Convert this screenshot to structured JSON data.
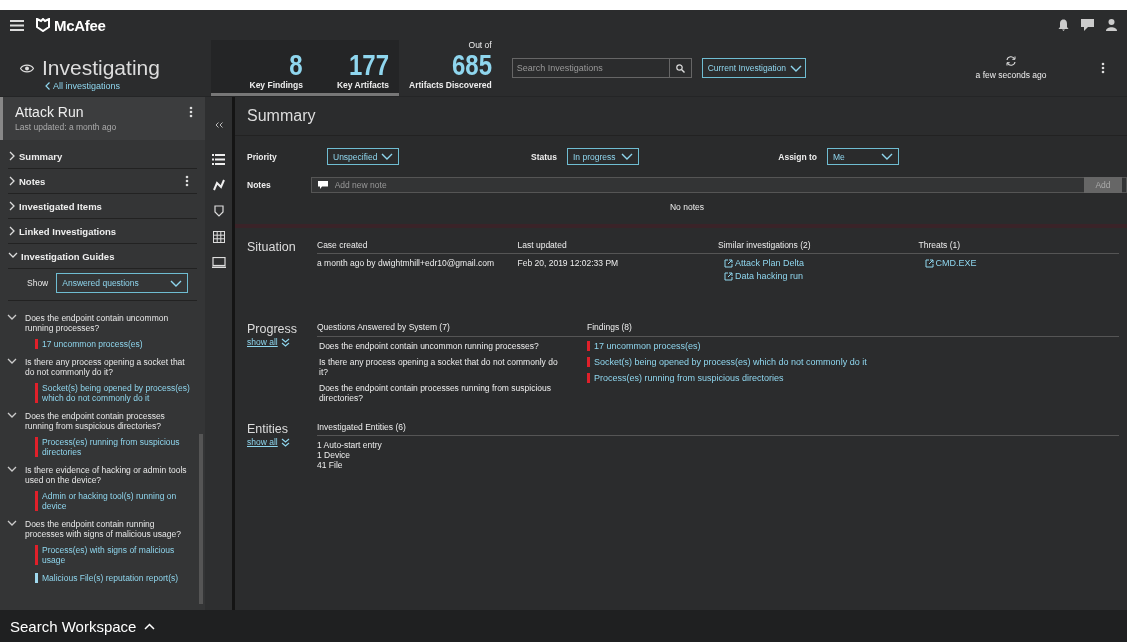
{
  "top_bar": {
    "logo": "McAfee"
  },
  "header": {
    "title": "Investigating",
    "back_link": "All investigations",
    "stats": [
      {
        "value": "8",
        "label": "Key Findings"
      },
      {
        "value": "177",
        "label": "Key Artifacts"
      }
    ],
    "total": {
      "caption": "Out of",
      "value": "685",
      "label": "Artifacts Discovered"
    },
    "search": {
      "placeholder": "Search Investigations"
    },
    "scope": {
      "value": "Current Investigation"
    },
    "refresh": {
      "text": "a few seconds ago"
    }
  },
  "sidebar": {
    "title": "Attack Run",
    "subtitle": "Last updated: a month ago",
    "sections": [
      {
        "label": "Summary",
        "expanded": false,
        "menu": false
      },
      {
        "label": "Notes",
        "expanded": false,
        "menu": true
      },
      {
        "label": "Investigated Items",
        "expanded": false,
        "menu": false
      },
      {
        "label": "Linked Investigations",
        "expanded": false,
        "menu": false
      },
      {
        "label": "Investigation Guides",
        "expanded": true,
        "menu": false
      }
    ],
    "show_label": "Show",
    "show_value": "Answered questions",
    "guides": [
      {
        "question": "Does the endpoint contain uncommon running processes?",
        "expanded": true,
        "findings": [
          {
            "text": "17 uncommon process(es)",
            "color": "#e0202a"
          }
        ]
      },
      {
        "question": "Is there any process opening a socket that do not commonly do it?",
        "expanded": true,
        "findings": [
          {
            "text": "Socket(s) being opened by process(es) which do not commonly do it",
            "color": "#e0202a"
          }
        ]
      },
      {
        "question": "Does the endpoint contain processes running from suspicious directories?",
        "expanded": true,
        "findings": [
          {
            "text": "Process(es) running from suspicious directories",
            "color": "#e0202a"
          }
        ]
      },
      {
        "question": "Is there evidence of hacking or admin tools used on the device?",
        "expanded": true,
        "findings": [
          {
            "text": "Admin or hacking tool(s) running on device",
            "color": "#e0202a"
          }
        ]
      },
      {
        "question": "Does the endpoint contain running processes with signs of malicious usage?",
        "expanded": true,
        "findings": [
          {
            "text": "Process(es) with signs of malicious usage",
            "color": "#e0202a"
          },
          {
            "text": "Malicious File(s) reputation report(s)",
            "color": "#9fd8ee"
          }
        ]
      }
    ]
  },
  "main": {
    "title": "Summary",
    "fields": [
      {
        "label": "Priority",
        "value": "Unspecified"
      },
      {
        "label": "Status",
        "value": "In progress"
      },
      {
        "label": "Assign to",
        "value": "Me"
      }
    ],
    "notes": {
      "label": "Notes",
      "placeholder": "Add new note",
      "button": "Add",
      "empty": "No notes"
    },
    "situation": {
      "label": "Situation",
      "columns": [
        {
          "heading": "Case created",
          "items": [
            {
              "text": "a month ago by dwightmhill+edr10@gmail.com",
              "kind": "text"
            }
          ]
        },
        {
          "heading": "Last updated",
          "items": [
            {
              "text": "Feb 20, 2019 12:02:33 PM",
              "kind": "text"
            }
          ]
        },
        {
          "heading": "Similar investigations (2)",
          "items": [
            {
              "text": "Attack Plan Delta",
              "kind": "link"
            },
            {
              "text": "Data hacking run",
              "kind": "link"
            }
          ]
        },
        {
          "heading": "Threats (1)",
          "items": [
            {
              "text": "CMD.EXE",
              "kind": "link"
            }
          ]
        }
      ]
    },
    "progress": {
      "label": "Progress",
      "show_all": "show all",
      "questions_heading": "Questions Answered by System (7)",
      "findings_heading": "Findings (8)",
      "questions": [
        "Does the endpoint contain uncommon running processes?",
        "Is there any process opening a socket that do not commonly do it?",
        "Does the endpoint contain processes running from suspicious directories?"
      ],
      "findings": [
        {
          "text": "17 uncommon process(es)",
          "color": "#e0202a"
        },
        {
          "text": "Socket(s) being opened by process(es) which do not commonly do it",
          "color": "#e0202a"
        },
        {
          "text": "Process(es) running from suspicious directories",
          "color": "#e0202a"
        }
      ]
    },
    "entities": {
      "label": "Entities",
      "show_all": "show all",
      "heading": "Investigated Entities (6)",
      "items": [
        "1 Auto-start entry",
        "1 Device",
        "41 File"
      ]
    }
  },
  "footer": {
    "label": "Search Workspace"
  }
}
